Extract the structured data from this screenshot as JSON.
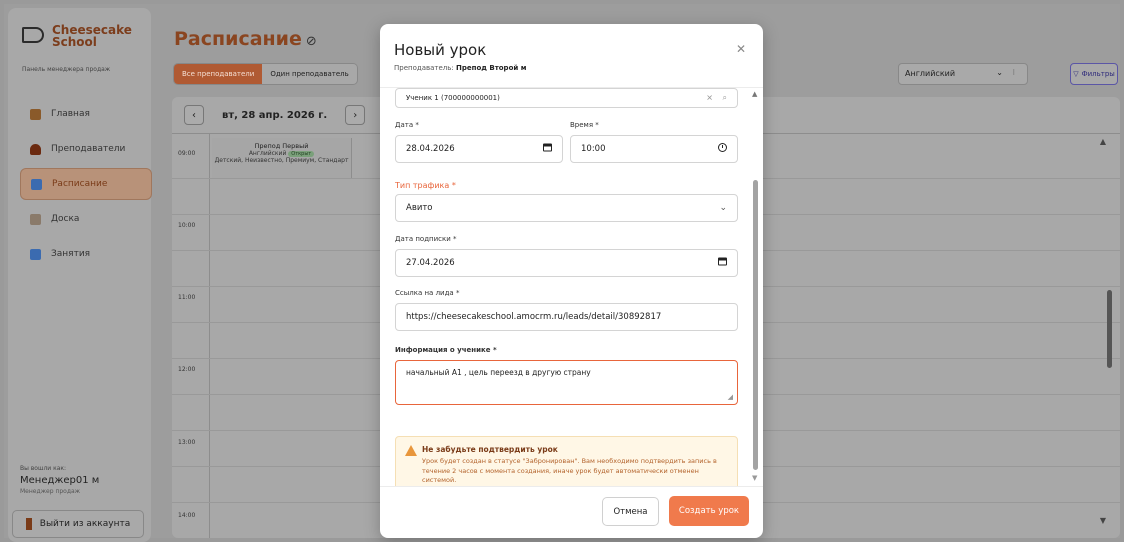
{
  "sidebar": {
    "logo_line1": "Cheesecake",
    "logo_line2": "School",
    "subtitle": "Панель менеджера продаж",
    "items": [
      {
        "label": "Главная",
        "color": "#8a5a2a"
      },
      {
        "label": "Преподаватели",
        "color": "#6b2a10"
      },
      {
        "label": "Расписание",
        "color": "#3b6bb0"
      },
      {
        "label": "Доска",
        "color": "#8a7a6a"
      },
      {
        "label": "Занятия",
        "color": "#3b6bb0"
      }
    ],
    "logged_in_as": "Вы вошли как:",
    "user_name": "Менеджер01 м",
    "user_role": "Менеджер продаж",
    "logout": "Выйти из аккаунта"
  },
  "header": {
    "title": "Расписание",
    "tab_all": "Все преподаватели",
    "tab_one": "Один преподаватель",
    "language": "Английский",
    "filters": "Фильтры"
  },
  "schedule": {
    "date": "вт, 28 апр. 2026 г.",
    "teacher_name": "Препод Первый",
    "teacher_lang": "Английский",
    "teacher_badge": "Открыт",
    "teacher_tags": "Детский, Неизвестно, Премиум, Стандарт",
    "times": [
      "09:00",
      "10:00",
      "11:00",
      "12:00",
      "13:00",
      "14:00"
    ]
  },
  "modal": {
    "title": "Новый урок",
    "teacher_prefix": "Преподаватель:",
    "teacher": "Препод Второй м",
    "student_value": "Ученик 1 (700000000001)",
    "date_label": "Дата *",
    "date_value": "28.04.2026",
    "time_label": "Время *",
    "time_value": "10:00",
    "traffic_label": "Тип трафика *",
    "traffic_value": "Авито",
    "sub_date_label": "Дата подписки *",
    "sub_date_value": "27.04.2026",
    "lead_label": "Ссылка на лида *",
    "lead_value": "https://cheesecakeschool.amocrm.ru/leads/detail/30892817",
    "info_label": "Информация о ученике *",
    "info_value": "начальный А1 , цель переезд в другую страну",
    "warn_title": "Не забудьте подтвердить урок",
    "warn_text": "Урок будет создан в статусе \"Забронирован\". Вам необходимо подтвердить запись в течение 2 часов с момента создания, иначе урок будет автоматически отменен системой.",
    "cancel": "Отмена",
    "create": "Создать урок"
  }
}
